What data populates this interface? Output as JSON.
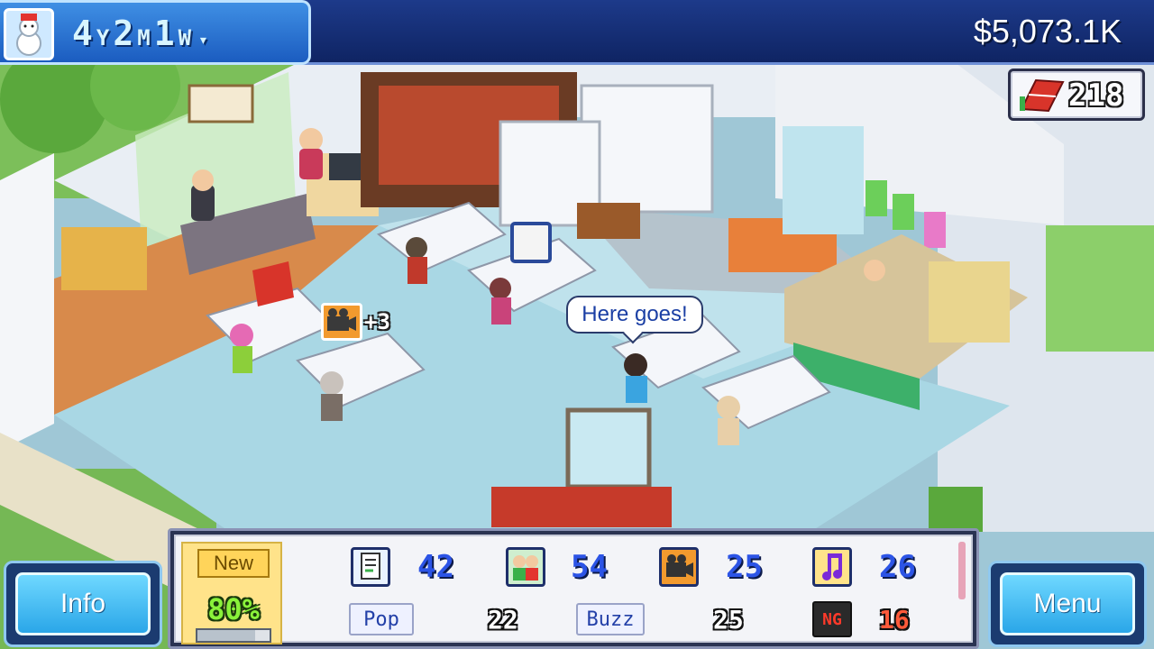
{
  "top_bar": {
    "date": {
      "years": "4",
      "year_unit": "Y",
      "months": "2",
      "month_unit": "M",
      "weeks": "1",
      "week_unit": "W"
    },
    "dropdown_glyph": "▾",
    "money": "$5,073.1K",
    "season_icon": "snowman-icon"
  },
  "fans": {
    "count": "218",
    "icon": "fan-flags-icon"
  },
  "scene": {
    "speech_bubble": "Here goes!",
    "floating_bonus": {
      "icon": "graphics-camera-icon",
      "text": "+3"
    }
  },
  "buttons": {
    "info": "Info",
    "menu": "Menu"
  },
  "stats": {
    "new_label": "New",
    "progress_text": "80%",
    "progress_value": 0.8,
    "fun": {
      "icon": "document-icon",
      "value": "42"
    },
    "creativity": {
      "icon": "people-icon",
      "value": "54"
    },
    "graphics": {
      "icon": "camera-icon",
      "value": "25"
    },
    "sound": {
      "icon": "music-note-icon",
      "value": "26"
    },
    "pop_label": "Pop",
    "pop_value": "22",
    "buzz_label": "Buzz",
    "buzz_value": "25",
    "ng_label": "NG",
    "ng_value": "16"
  },
  "colors": {
    "accent_blue": "#2c54e6",
    "bug_red": "#e83a2a",
    "money_bar": "#0f2463",
    "button_cyan": "#2aa6e8"
  }
}
